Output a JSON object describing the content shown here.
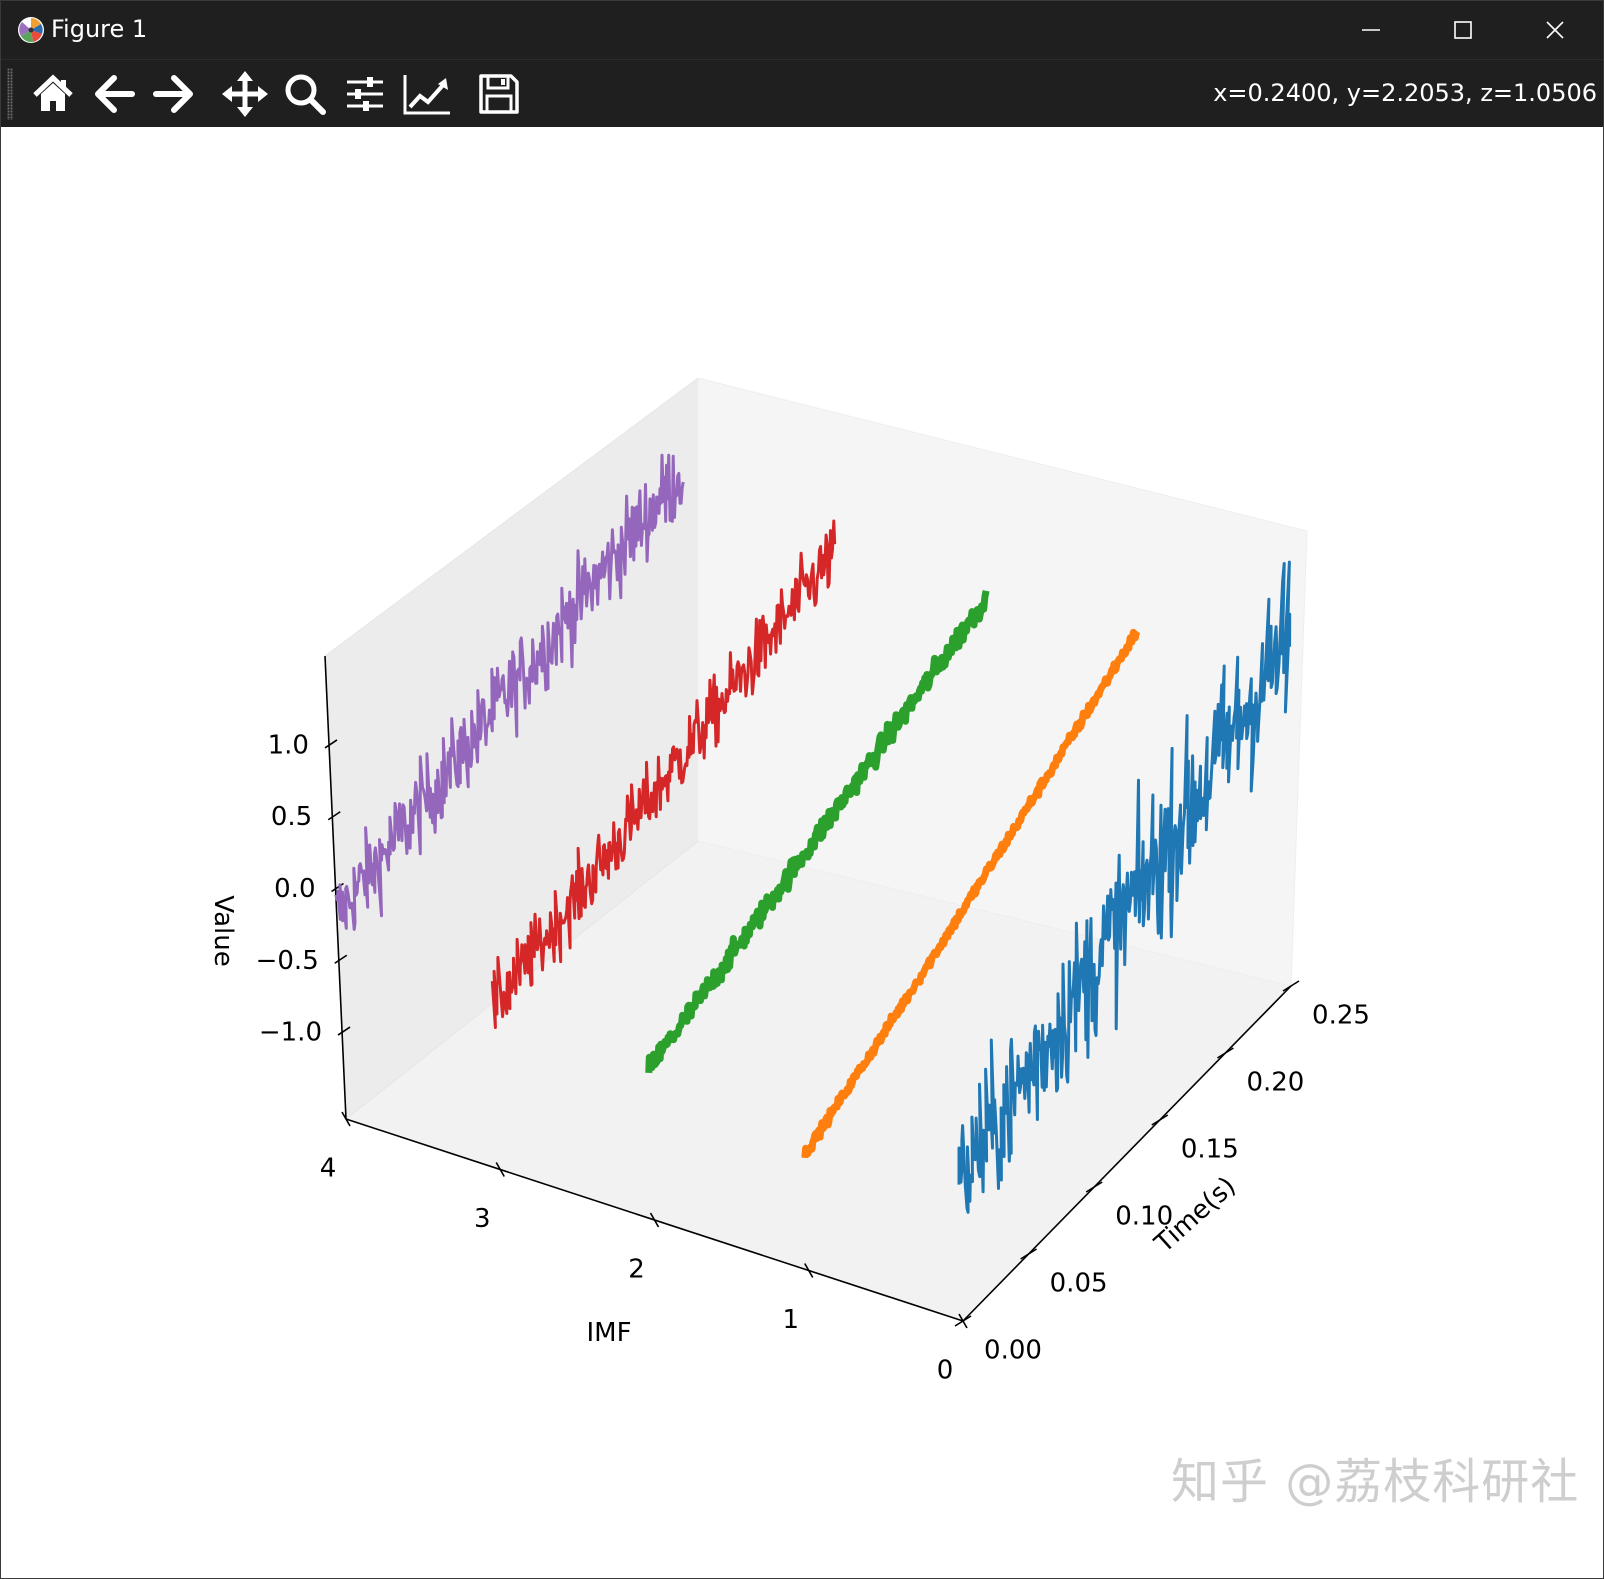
{
  "window": {
    "title": "Figure 1",
    "controls": {
      "minimize": "minimize",
      "maximize": "maximize",
      "close": "close"
    }
  },
  "toolbar": {
    "tools": [
      {
        "name": "home-icon",
        "label": "Home"
      },
      {
        "name": "back-icon",
        "label": "Back"
      },
      {
        "name": "forward-icon",
        "label": "Forward"
      },
      {
        "name": "pan-icon",
        "label": "Pan"
      },
      {
        "name": "zoom-icon",
        "label": "Zoom"
      },
      {
        "name": "subplots-icon",
        "label": "Configure subplots"
      },
      {
        "name": "edit-axis-icon",
        "label": "Edit axis"
      },
      {
        "name": "save-icon",
        "label": "Save"
      }
    ],
    "coordinates": "x=0.2400, y=2.2053, z=1.0506"
  },
  "chart_data": {
    "type": "line3d",
    "title": "",
    "xlabel": "Time(s)",
    "ylabel": "IMF",
    "zlabel": "Value",
    "xlim": [
      0.0,
      0.25
    ],
    "ylim": [
      0,
      4
    ],
    "zlim": [
      -1.0,
      1.0
    ],
    "x_ticks": [
      "0.00",
      "0.05",
      "0.10",
      "0.15",
      "0.20",
      "0.25"
    ],
    "y_ticks": [
      "0",
      "1",
      "2",
      "3",
      "4"
    ],
    "z_ticks": [
      "−1.0",
      "−0.5",
      "0.0",
      "0.5",
      "1.0"
    ],
    "grid": false,
    "series": [
      {
        "imf": 0,
        "color": "#1f77b4",
        "x_range": [
          0.0,
          0.24
        ],
        "trend": [
          -0.3,
          1.0
        ],
        "noise_amplitude": 0.75
      },
      {
        "imf": 1,
        "color": "#ff7f0e",
        "x_range": [
          0.0,
          0.24
        ],
        "trend": [
          -0.6,
          0.75
        ],
        "noise_amplitude": 0.05
      },
      {
        "imf": 2,
        "color": "#2ca02c",
        "x_range": [
          0.0,
          0.24
        ],
        "trend": [
          -0.4,
          0.7
        ],
        "noise_amplitude": 0.1
      },
      {
        "imf": 3,
        "color": "#d62728",
        "x_range": [
          0.0,
          0.24
        ],
        "trend": [
          -0.4,
          0.75
        ],
        "noise_amplitude": 0.3
      },
      {
        "imf": 4,
        "color": "#9467bd",
        "x_range": [
          0.0,
          0.24
        ],
        "trend": [
          -0.2,
          1.05
        ],
        "noise_amplitude": 0.35
      }
    ]
  },
  "watermark": "知乎 @荔枝科研社"
}
